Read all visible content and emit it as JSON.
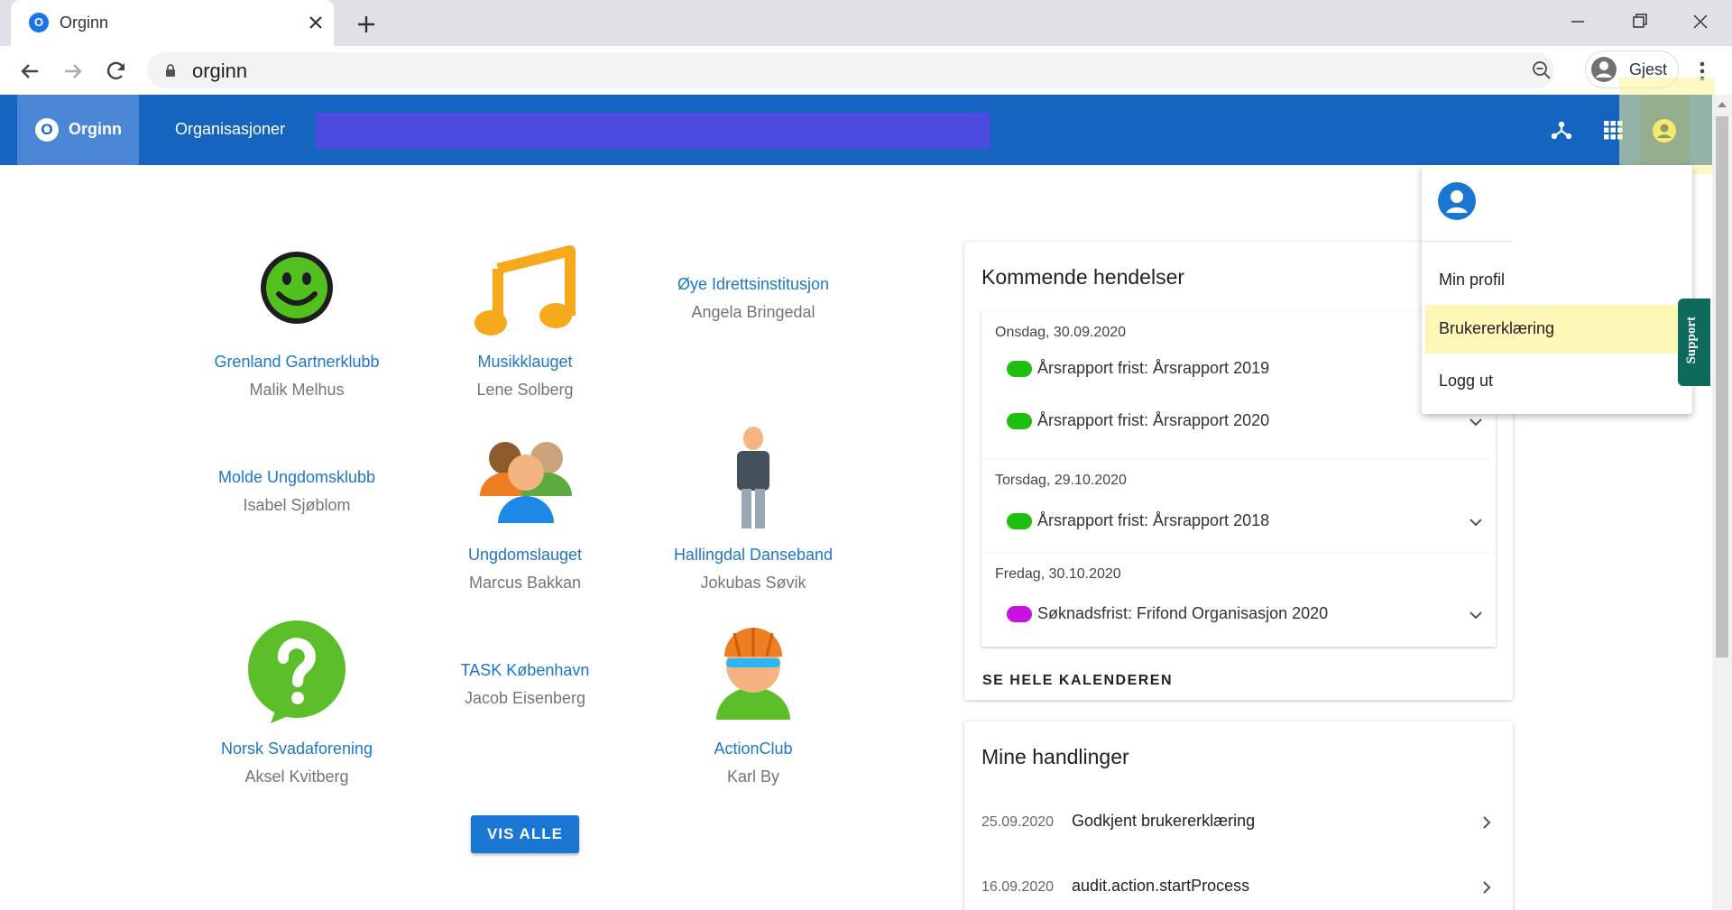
{
  "browser": {
    "tab_title": "Orginn",
    "tab_favicon_letter": "O",
    "url": "orginn",
    "profile_label": "Gjest"
  },
  "appbar": {
    "brand_letter": "O",
    "brand_name": "Orginn",
    "nav_organizations": "Organisasjoner",
    "icons": [
      "network-icon",
      "apps-grid-icon",
      "account-circle-icon"
    ]
  },
  "organizations": [
    {
      "name": "Grenland Gartnerklubb",
      "person": "Malik Melhus",
      "icon": "smiley-icon"
    },
    {
      "name": "Musikklauget",
      "person": "Lene Solberg",
      "icon": "music-note-icon"
    },
    {
      "name": "Øye Idrettsinstitusjon",
      "person": "Angela Bringedal",
      "icon": ""
    },
    {
      "name": "Molde Ungdomsklubb",
      "person": "Isabel Sjøblom",
      "icon": ""
    },
    {
      "name": "Ungdomslauget",
      "person": "Marcus Bakkan",
      "icon": "group-people-icon"
    },
    {
      "name": "Hallingdal Danseband",
      "person": "Jokubas Søvik",
      "icon": "standing-person-icon"
    },
    {
      "name": "Norsk Svadaforening",
      "person": "Aksel Kvitberg",
      "icon": "question-bubble-icon"
    },
    {
      "name": "TASK København",
      "person": "Jacob Eisenberg",
      "icon": ""
    },
    {
      "name": "ActionClub",
      "person": "Karl By",
      "icon": "cyclist-helmet-icon"
    }
  ],
  "vis_alle_label": "VIS ALLE",
  "calendar": {
    "title": "Kommende hendelser",
    "groups": [
      {
        "date": "Onsdag, 30.09.2020",
        "events": [
          {
            "label": "Årsrapport frist: Årsrapport 2019",
            "color": "#1fbf12"
          },
          {
            "label": "Årsrapport frist: Årsrapport 2020",
            "color": "#1fbf12"
          }
        ]
      },
      {
        "date": "Torsdag, 29.10.2020",
        "events": [
          {
            "label": "Årsrapport frist: Årsrapport 2018",
            "color": "#1fbf12"
          }
        ]
      },
      {
        "date": "Fredag, 30.10.2020",
        "events": [
          {
            "label": "Søknadsfrist: Frifond Organisasjon 2020",
            "color": "#c613e0"
          }
        ]
      }
    ],
    "see_all_label": "SE HELE KALENDEREN"
  },
  "actions": {
    "title": "Mine handlinger",
    "items": [
      {
        "date": "25.09.2020",
        "label": "Godkjent brukererklæring"
      },
      {
        "date": "16.09.2020",
        "label": "audit.action.startProcess"
      }
    ]
  },
  "account_menu": {
    "items": [
      "Min profil",
      "Brukererklæring",
      "Logg ut"
    ],
    "active_item": "Brukererklæring"
  },
  "support_label": "Support",
  "colors": {
    "appbar": "#1565c0",
    "link": "#1e76c7",
    "primary_button": "#1976d2",
    "support_tab": "#0e6b5c",
    "menu_highlight": "#fdf7b8"
  }
}
